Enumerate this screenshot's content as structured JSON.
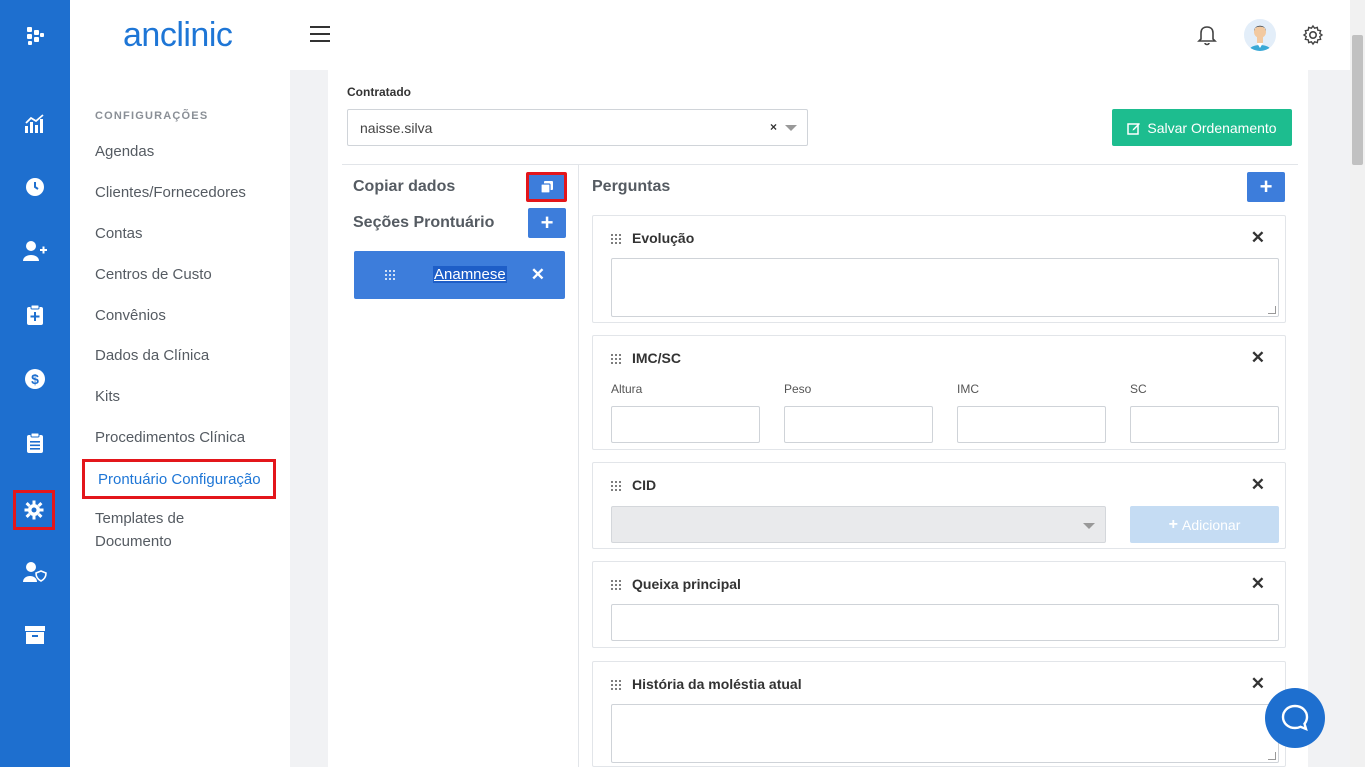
{
  "app": {
    "logo_text": "anclinic"
  },
  "colors": {
    "rail": "#1e6fcf",
    "primary": "#3d7ddb",
    "success": "#1dbd8f",
    "highlight": "#e3161b"
  },
  "rail_icons": [
    "logo-icon",
    "chart-icon",
    "clock-icon",
    "add-user-icon",
    "clipboard-plus-icon",
    "dollar-icon",
    "clipboard-list-icon",
    "gear-icon",
    "user-shield-icon",
    "archive-icon"
  ],
  "settings": {
    "title": "CONFIGURAÇÕES",
    "items": [
      {
        "label": "Agendas"
      },
      {
        "label": "Clientes/Fornecedores"
      },
      {
        "label": "Contas"
      },
      {
        "label": "Centros de Custo"
      },
      {
        "label": "Convênios"
      },
      {
        "label": "Dados da Clínica"
      },
      {
        "label": "Kits"
      },
      {
        "label": "Procedimentos Clínica"
      },
      {
        "label": "Prontuário Configuração"
      },
      {
        "label": "Templates de",
        "label2": "Documento"
      }
    ]
  },
  "form": {
    "contratado_label": "Contratado",
    "contratado_value": "naisse.silva",
    "clear_symbol": "×",
    "save_button": "Salvar Ordenamento"
  },
  "left_panel": {
    "copy_label": "Copiar dados",
    "sections_label": "Seções Prontuário",
    "sections": [
      {
        "name": "Anamnese"
      }
    ]
  },
  "questions_panel": {
    "title": "Perguntas",
    "cards": [
      {
        "title": "Evolução"
      },
      {
        "title": "IMC/SC",
        "fields": [
          "Altura",
          "Peso",
          "IMC",
          "SC"
        ]
      },
      {
        "title": "CID",
        "add_button": "Adicionar"
      },
      {
        "title": "Queixa principal"
      },
      {
        "title": "História da moléstia atual"
      }
    ]
  },
  "close_symbol": "✕",
  "plus_symbol": "+"
}
